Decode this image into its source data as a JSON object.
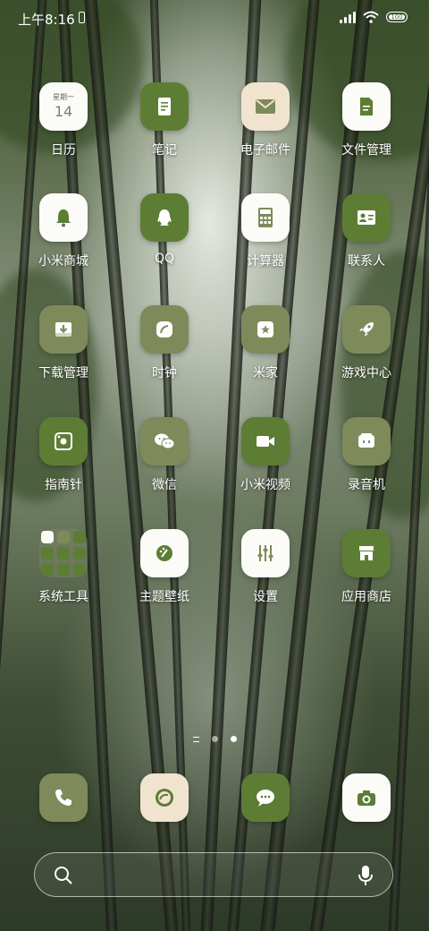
{
  "status_bar": {
    "time": "上午8:16",
    "battery": "100"
  },
  "apps": [
    {
      "label": "日历",
      "icon": "calendar-icon",
      "cal_weekday": "星期一",
      "cal_day": "14"
    },
    {
      "label": "笔记",
      "icon": "notes-icon"
    },
    {
      "label": "电子邮件",
      "icon": "mail-icon"
    },
    {
      "label": "文件管理",
      "icon": "file-manager-icon"
    },
    {
      "label": "小米商城",
      "icon": "bell-icon"
    },
    {
      "label": "QQ",
      "icon": "qq-icon"
    },
    {
      "label": "计算器",
      "icon": "calculator-icon"
    },
    {
      "label": "联系人",
      "icon": "contacts-icon"
    },
    {
      "label": "下载管理",
      "icon": "download-icon"
    },
    {
      "label": "时钟",
      "icon": "clock-icon"
    },
    {
      "label": "米家",
      "icon": "mijia-icon"
    },
    {
      "label": "游戏中心",
      "icon": "rocket-icon"
    },
    {
      "label": "指南针",
      "icon": "compass-icon"
    },
    {
      "label": "微信",
      "icon": "wechat-icon"
    },
    {
      "label": "小米视频",
      "icon": "video-icon"
    },
    {
      "label": "录音机",
      "icon": "recorder-icon"
    },
    {
      "label": "系统工具",
      "icon": "folder-icon"
    },
    {
      "label": "主题壁纸",
      "icon": "theme-icon"
    },
    {
      "label": "设置",
      "icon": "settings-icon"
    },
    {
      "label": "应用商店",
      "icon": "store-icon"
    }
  ],
  "dock": [
    {
      "icon": "phone-icon"
    },
    {
      "icon": "browser-icon"
    },
    {
      "icon": "messages-icon"
    },
    {
      "icon": "camera-icon"
    }
  ],
  "colors": {
    "green": "#5d7d35",
    "olive": "#7e8a5a",
    "cream": "#f0e4cf",
    "white": "#fbfbf8"
  }
}
